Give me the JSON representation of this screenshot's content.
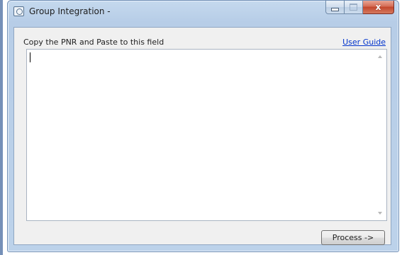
{
  "window": {
    "title": "Group Integration -",
    "controls": {
      "minimize": "minimize",
      "maximize": "maximize",
      "close": "x"
    }
  },
  "form": {
    "instruction": "Copy the PNR and Paste to this field",
    "user_guide_link": "User Guide",
    "pnr_value": "",
    "process_button": "Process ->"
  },
  "icons": {
    "app": "app-icon",
    "scroll_up": "chevron-up-icon",
    "scroll_down": "chevron-down-icon"
  },
  "colors": {
    "title_bar": "#bcd2ea",
    "close_button": "#c2452b",
    "link": "#0033cc"
  }
}
